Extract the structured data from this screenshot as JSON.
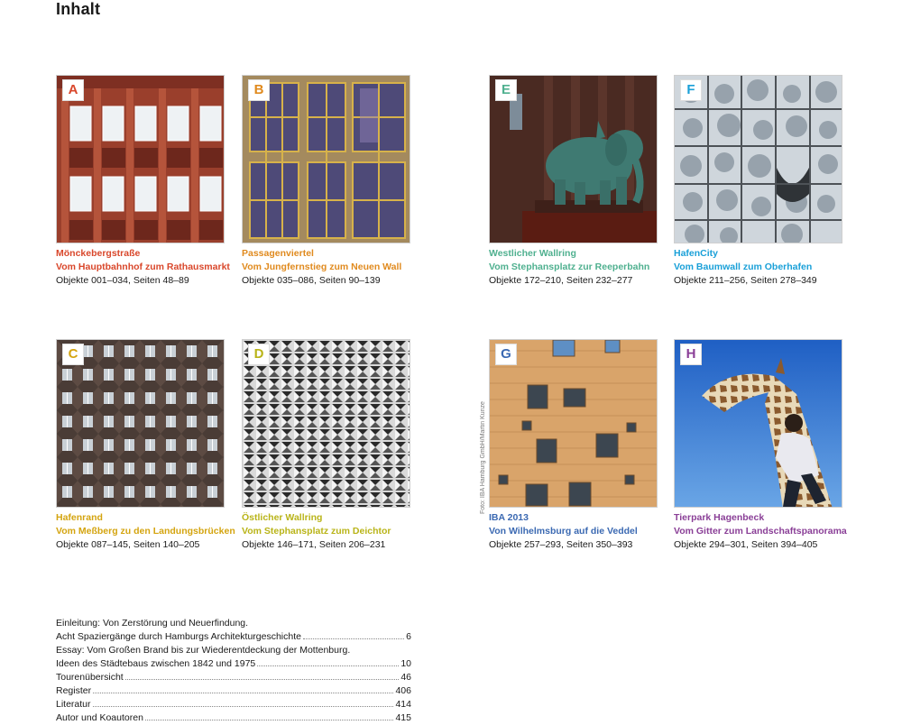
{
  "page_title": "Inhalt",
  "colors": {
    "A": "#d9472b",
    "B": "#e08a1e",
    "C": "#d4a40f",
    "D": "#b9b418",
    "E": "#4fb08f",
    "F": "#1aa0d8",
    "G": "#3b69b2",
    "H": "#8a3f97"
  },
  "tiles": [
    {
      "letter": "A",
      "area": "Mönckebergstraße",
      "route": "Vom Hauptbahnhof zum Rathausmarkt",
      "meta": "Objekte 001–034, Seiten 48–89"
    },
    {
      "letter": "B",
      "area": "Passagenviertel",
      "route": "Vom Jungfernstieg zum Neuen Wall",
      "meta": "Objekte 035–086, Seiten 90–139"
    },
    {
      "letter": "E",
      "area": "Westlicher Wallring",
      "route": "Vom Stephansplatz zur Reeperbahn",
      "meta": "Objekte 172–210, Seiten 232–277"
    },
    {
      "letter": "F",
      "area": "HafenCity",
      "route": "Vom Baumwall zum Oberhafen",
      "meta": "Objekte 211–256, Seiten 278–349"
    },
    {
      "letter": "C",
      "area": "Hafenrand",
      "route": "Vom Meßberg zu den Landungsbrücken",
      "meta": "Objekte 087–145, Seiten 140–205"
    },
    {
      "letter": "D",
      "area": "Östlicher Wallring",
      "route": "Vom Stephansplatz zum Deichtor",
      "meta": "Objekte 146–171, Seiten 206–231"
    },
    {
      "letter": "G",
      "area": "IBA 2013",
      "route": "Von Wilhelmsburg auf die Veddel",
      "meta": "Objekte 257–293, Seiten 350–393"
    },
    {
      "letter": "H",
      "area": "Tierpark Hagenbeck",
      "route": "Vom Gitter zum Landschaftspanorama",
      "meta": "Objekte 294–301, Seiten 394–405"
    }
  ],
  "photo_credit": "Foto: IBA Hamburg GmbH/Martin Kunze",
  "toc": [
    {
      "title": "Einleitung: Von Zerstörung und Neuerfindung.",
      "page": ""
    },
    {
      "title": "Acht Spaziergänge durch Hamburgs Architekturgeschichte",
      "page": "6"
    },
    {
      "title": "Essay: Vom Großen Brand bis zur Wiederentdeckung der Mottenburg.",
      "page": ""
    },
    {
      "title": "Ideen des Städtebaus zwischen 1842 und 1975",
      "page": "10"
    },
    {
      "title": "Tourenübersicht",
      "page": "46"
    },
    {
      "title": "Register",
      "page": "406"
    },
    {
      "title": "Literatur",
      "page": "414"
    },
    {
      "title": "Autor und Koautoren",
      "page": "415"
    }
  ]
}
